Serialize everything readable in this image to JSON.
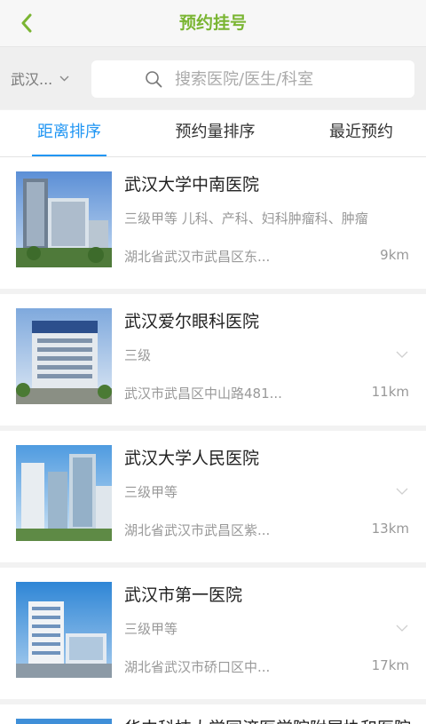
{
  "header": {
    "title": "预约挂号"
  },
  "search": {
    "city": "武汉...",
    "placeholder": "搜索医院/医生/科室"
  },
  "tabs": [
    {
      "label": "距离排序"
    },
    {
      "label": "预约量排序"
    },
    {
      "label": "最近预约"
    }
  ],
  "hospitals": [
    {
      "name": "武汉大学中南医院",
      "level": "三级甲等 儿科、产科、妇科肿瘤科、肿瘤",
      "address": "湖北省武汉市武昌区东...",
      "distance": "9km"
    },
    {
      "name": "武汉爱尔眼科医院",
      "level": "三级",
      "address": "武汉市武昌区中山路481...",
      "distance": "11km"
    },
    {
      "name": "武汉大学人民医院",
      "level": "三级甲等",
      "address": "湖北省武汉市武昌区紫...",
      "distance": "13km"
    },
    {
      "name": "武汉市第一医院",
      "level": "三级甲等",
      "address": "湖北省武汉市硚口区中...",
      "distance": "17km"
    },
    {
      "name": "华中科技大学同济医学院附属协和医院",
      "level": "",
      "address": "",
      "distance": ""
    }
  ],
  "colors": {
    "accent_green": "#7ab532",
    "active_tab_blue": "#2196f3"
  },
  "icons": {
    "back": "chevron-left-icon",
    "dropdown": "chevron-down-icon",
    "search": "search-icon",
    "expand": "chevron-down-icon"
  }
}
